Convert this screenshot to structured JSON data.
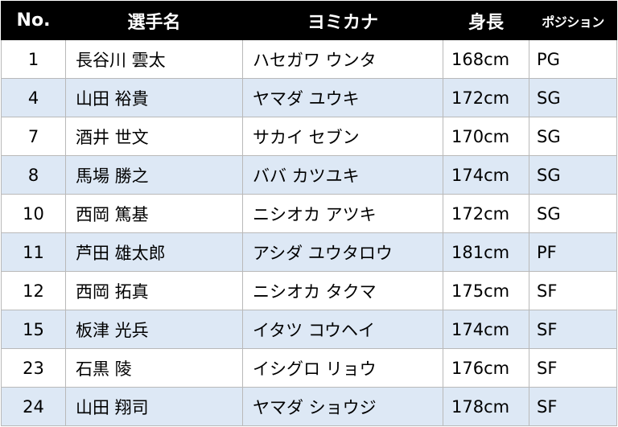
{
  "table": {
    "headers": {
      "no": "No.",
      "name": "選手名",
      "kana": "ヨミカナ",
      "height": "身長",
      "position": "ポジション"
    },
    "rows": [
      {
        "no": "1",
        "name": "長谷川 雲太",
        "kana": "ハセガワ ウンタ",
        "height": "168cm",
        "position": "PG"
      },
      {
        "no": "4",
        "name": "山田 裕貴",
        "kana": "ヤマダ ユウキ",
        "height": "172cm",
        "position": "SG"
      },
      {
        "no": "7",
        "name": "酒井 世文",
        "kana": "サカイ セブン",
        "height": "170cm",
        "position": "SG"
      },
      {
        "no": "8",
        "name": "馬場 勝之",
        "kana": "ババ カツユキ",
        "height": "174cm",
        "position": "SG"
      },
      {
        "no": "10",
        "name": "西岡 篤基",
        "kana": "ニシオカ アツキ",
        "height": "172cm",
        "position": "SG"
      },
      {
        "no": "11",
        "name": "芦田 雄太郎",
        "kana": "アシダ ユウタロウ",
        "height": "181cm",
        "position": "PF"
      },
      {
        "no": "12",
        "name": "西岡 拓真",
        "kana": "ニシオカ タクマ",
        "height": "175cm",
        "position": "SF"
      },
      {
        "no": "15",
        "name": "板津 光兵",
        "kana": "イタツ コウヘイ",
        "height": "174cm",
        "position": "SF"
      },
      {
        "no": "23",
        "name": "石黒 陵",
        "kana": "イシグロ リョウ",
        "height": "176cm",
        "position": "SF"
      },
      {
        "no": "24",
        "name": "山田 翔司",
        "kana": "ヤマダ ショウジ",
        "height": "178cm",
        "position": "SF"
      }
    ]
  }
}
